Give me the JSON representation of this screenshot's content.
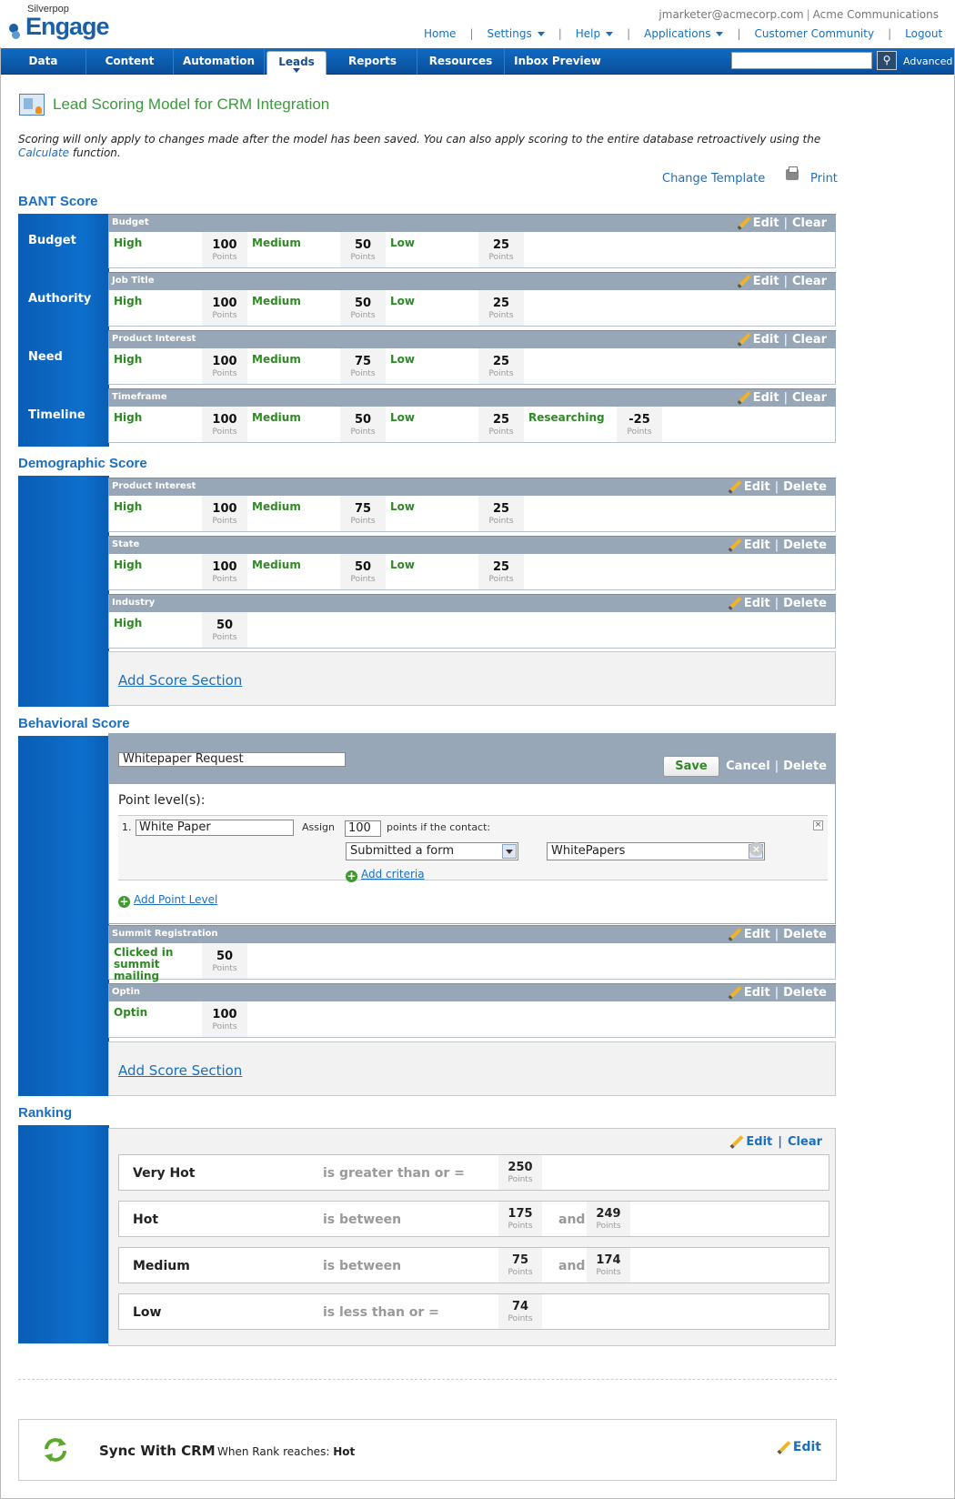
{
  "header": {
    "brand_top": "Silverpop",
    "brand_main": "Engage",
    "user_email": "jmarketer@acmecorp.com",
    "company": "Acme Communications",
    "links": [
      "Home",
      "Settings",
      "Help",
      "Applications",
      "Customer Community",
      "Logout"
    ]
  },
  "nav": {
    "tabs": [
      "Data",
      "Content",
      "Automation",
      "Leads",
      "Reports",
      "Resources",
      "Inbox Preview"
    ],
    "active_tab": "Leads",
    "search_value": "",
    "advanced_label": "Advanced"
  },
  "page": {
    "title": "Lead Scoring Model for CRM Integration",
    "note_text": "Scoring will only apply to changes made after the model has been saved. You can also apply scoring to the entire database retroactively using the",
    "note_link": "Calculate",
    "note_end": "function.",
    "change_template": "Change Template",
    "print": "Print"
  },
  "labels": {
    "points": "Points",
    "edit": "Edit",
    "clear": "Clear",
    "delete": "Delete",
    "add_score_section": "Add Score Section"
  },
  "bant": {
    "heading": "BANT Score",
    "rows": [
      {
        "side": "Budget",
        "name": "Budget",
        "levels": [
          {
            "l": "High",
            "p": "100"
          },
          {
            "l": "Medium",
            "p": "50"
          },
          {
            "l": "Low",
            "p": "25"
          }
        ]
      },
      {
        "side": "Authority",
        "name": "Job Title",
        "levels": [
          {
            "l": "High",
            "p": "100"
          },
          {
            "l": "Medium",
            "p": "50"
          },
          {
            "l": "Low",
            "p": "25"
          }
        ]
      },
      {
        "side": "Need",
        "name": "Product Interest",
        "levels": [
          {
            "l": "High",
            "p": "100"
          },
          {
            "l": "Medium",
            "p": "75"
          },
          {
            "l": "Low",
            "p": "25"
          }
        ]
      },
      {
        "side": "Timeline",
        "name": "Timeframe",
        "levels": [
          {
            "l": "High",
            "p": "100"
          },
          {
            "l": "Medium",
            "p": "50"
          },
          {
            "l": "Low",
            "p": "25"
          },
          {
            "l": "Researching",
            "p": "-25"
          }
        ]
      }
    ]
  },
  "demographic": {
    "heading": "Demographic Score",
    "rows": [
      {
        "name": "Product Interest",
        "levels": [
          {
            "l": "High",
            "p": "100"
          },
          {
            "l": "Medium",
            "p": "75"
          },
          {
            "l": "Low",
            "p": "25"
          }
        ]
      },
      {
        "name": "State",
        "levels": [
          {
            "l": "High",
            "p": "100"
          },
          {
            "l": "Medium",
            "p": "50"
          },
          {
            "l": "Low",
            "p": "25"
          }
        ]
      },
      {
        "name": "Industry",
        "levels": [
          {
            "l": "High",
            "p": "50"
          }
        ]
      }
    ]
  },
  "behavioral": {
    "heading": "Behavioral Score",
    "editor": {
      "section_name": "Whitepaper Request",
      "save": "Save",
      "cancel": "Cancel",
      "delete": "Delete",
      "point_levels_label": "Point level(s):",
      "level_number": "1.",
      "level_name": "White Paper",
      "assign_label": "Assign",
      "assign_points": "100",
      "points_if": "points if the contact:",
      "criteria_action": "Submitted a form",
      "criteria_target": "WhitePapers",
      "add_criteria": "Add criteria",
      "add_point_level": "Add Point Level"
    },
    "rows": [
      {
        "name": "Summit Registration",
        "levels": [
          {
            "l": "Clicked in summit mailing",
            "p": "50"
          }
        ]
      },
      {
        "name": "Optin",
        "levels": [
          {
            "l": "Optin",
            "p": "100"
          }
        ]
      }
    ]
  },
  "ranking": {
    "heading": "Ranking",
    "rows": [
      {
        "name": "Very Hot",
        "op": "is greater than or =",
        "v1": "250",
        "v2": null
      },
      {
        "name": "Hot",
        "op": "is between",
        "v1": "175",
        "v2": "249"
      },
      {
        "name": "Medium",
        "op": "is between",
        "v1": "75",
        "v2": "174"
      },
      {
        "name": "Low",
        "op": "is less than or =",
        "v1": "74",
        "v2": null
      }
    ],
    "and_label": "and"
  },
  "sync": {
    "title": "Sync With CRM",
    "when_label": "When Rank reaches:",
    "when_value": "Hot",
    "edit": "Edit"
  }
}
